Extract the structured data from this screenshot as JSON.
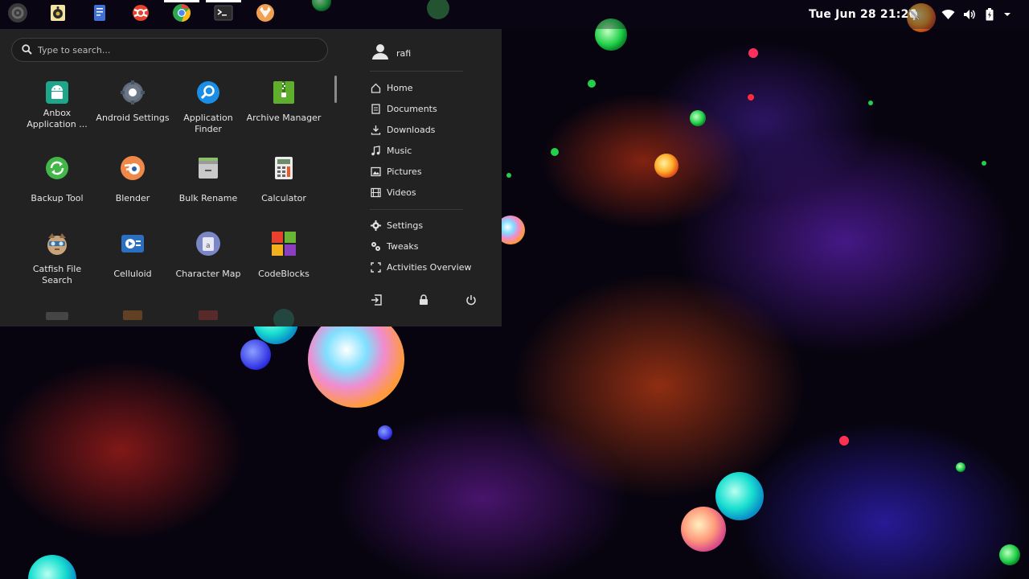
{
  "top_panel": {
    "activities_icon": "gnome-foot-icon",
    "clock": "Tue Jun 28  21:26",
    "launchers": [
      {
        "name": "speaker-app-icon"
      },
      {
        "name": "document-viewer-icon"
      },
      {
        "name": "help-lifebuoy-icon"
      },
      {
        "name": "chrome-browser-icon"
      },
      {
        "name": "terminal-icon"
      },
      {
        "name": "gitlab-fox-icon"
      }
    ],
    "tray": [
      "notifications-muted-icon",
      "wifi-icon",
      "volume-icon",
      "battery-icon",
      "system-menu-chevron-icon"
    ]
  },
  "app_menu": {
    "search": {
      "placeholder": "Type to search..."
    },
    "apps": [
      {
        "label": "Anbox Application ...",
        "icon": "android-box-icon"
      },
      {
        "label": "Android Settings",
        "icon": "gear-icon"
      },
      {
        "label": "Application Finder",
        "icon": "magnifier-icon"
      },
      {
        "label": "Archive Manager",
        "icon": "zip-archive-icon"
      },
      {
        "label": "Backup Tool",
        "icon": "backup-sync-icon"
      },
      {
        "label": "Blender",
        "icon": "blender-icon"
      },
      {
        "label": "Bulk Rename",
        "icon": "bulk-rename-icon"
      },
      {
        "label": "Calculator",
        "icon": "calculator-icon"
      },
      {
        "label": "Catfish File Search",
        "icon": "catfish-icon"
      },
      {
        "label": "Celluloid",
        "icon": "video-player-icon"
      },
      {
        "label": "Character Map",
        "icon": "character-map-icon"
      },
      {
        "label": "CodeBlocks",
        "icon": "codeblocks-icon"
      }
    ],
    "places": {
      "user": "rafi",
      "folders": [
        {
          "label": "Home",
          "icon": "home-icon"
        },
        {
          "label": "Documents",
          "icon": "documents-icon"
        },
        {
          "label": "Downloads",
          "icon": "download-icon"
        },
        {
          "label": "Music",
          "icon": "music-note-icon"
        },
        {
          "label": "Pictures",
          "icon": "picture-icon"
        },
        {
          "label": "Videos",
          "icon": "film-icon"
        }
      ],
      "system": [
        {
          "label": "Settings",
          "icon": "gear-icon"
        },
        {
          "label": "Tweaks",
          "icon": "tweaks-icon"
        },
        {
          "label": "Activities Overview",
          "icon": "overview-frame-icon"
        }
      ],
      "session": [
        "logout-icon",
        "lock-icon",
        "power-icon"
      ]
    }
  }
}
